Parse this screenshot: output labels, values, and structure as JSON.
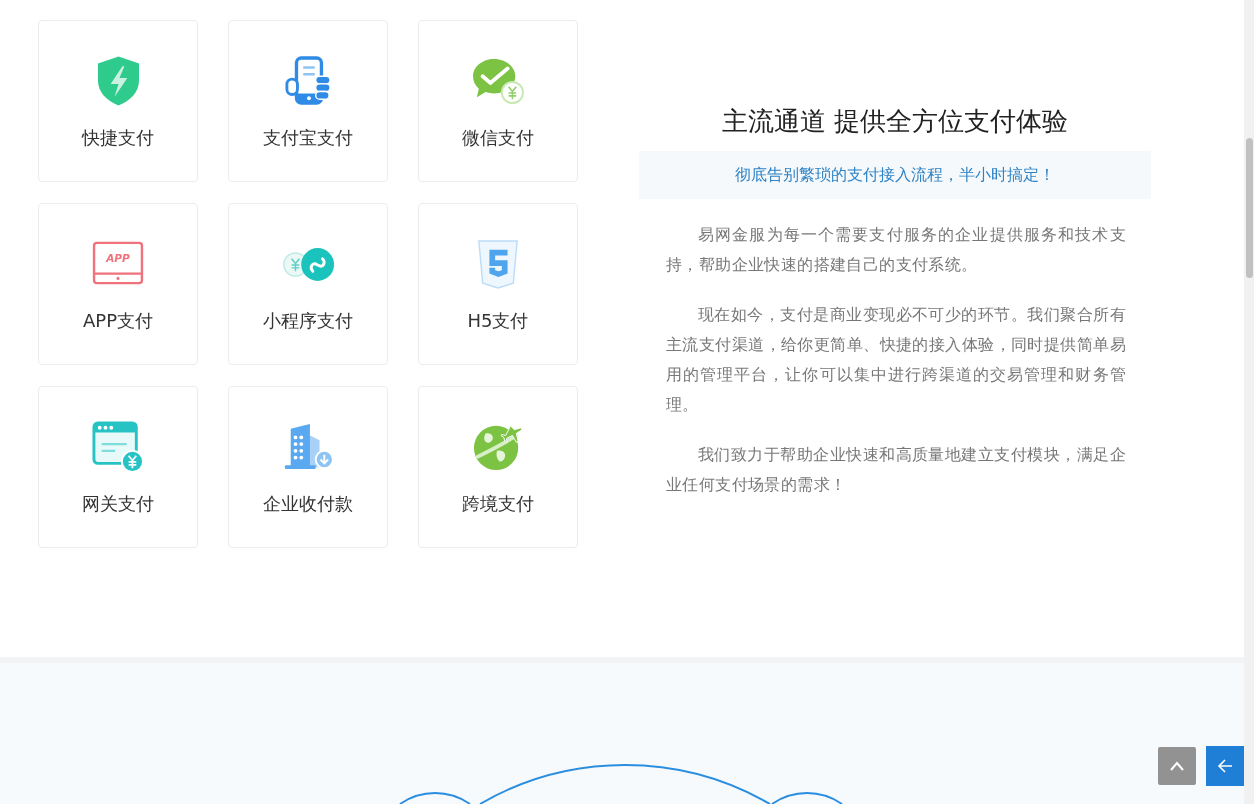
{
  "payment_methods": [
    {
      "label": "快捷支付",
      "kind": "shield"
    },
    {
      "label": "支付宝支付",
      "kind": "phone"
    },
    {
      "label": "微信支付",
      "kind": "chat"
    },
    {
      "label": "APP支付",
      "kind": "tablet",
      "icon_text": "APP"
    },
    {
      "label": "小程序支付",
      "kind": "miniapp"
    },
    {
      "label": "H5支付",
      "kind": "html5"
    },
    {
      "label": "网关支付",
      "kind": "gateway"
    },
    {
      "label": "企业收付款",
      "kind": "building"
    },
    {
      "label": "跨境支付",
      "kind": "globe"
    }
  ],
  "intro": {
    "title": "主流通道 提供全方位支付体验",
    "tagline": "彻底告别繁琐的支付接入流程，半小时搞定！",
    "paragraphs": [
      "易网金服为每一个需要支付服务的企业提供服务和技术支持，帮助企业快速的搭建自己的支付系统。",
      "现在如今，支付是商业变现必不可少的环节。我们聚合所有主流支付渠道，给你更简单、快捷的接入体验，同时提供简单易用的管理平台，让你可以集中进行跨渠道的交易管理和财务管理。",
      "我们致力于帮助企业快速和高质量地建立支付模块，满足企业任何支付场景的需求！"
    ]
  },
  "side_buttons": [
    {
      "kind": "top"
    },
    {
      "kind": "collapse"
    }
  ]
}
